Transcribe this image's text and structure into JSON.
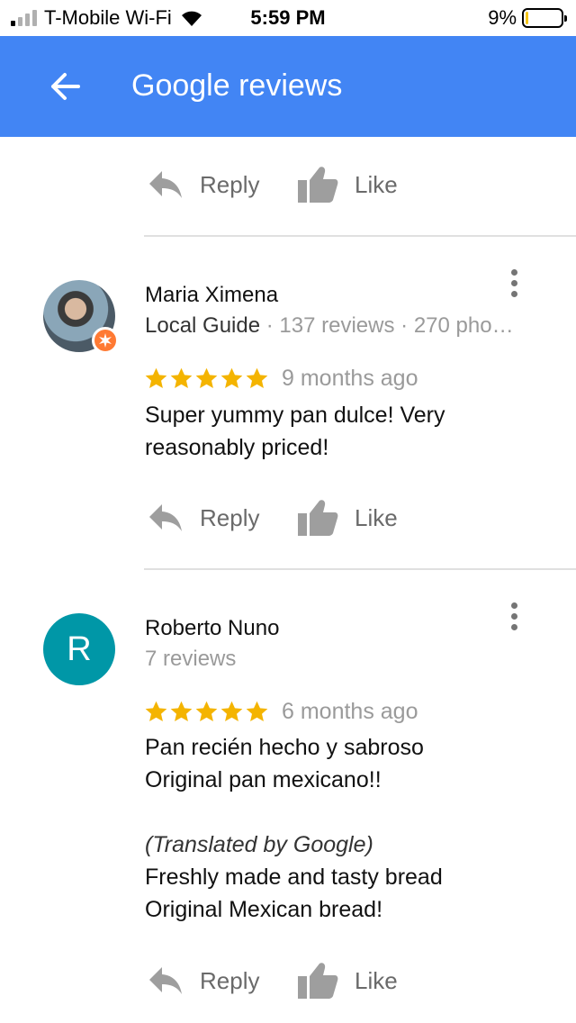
{
  "status_bar": {
    "carrier": "T-Mobile Wi-Fi",
    "time": "5:59 PM",
    "battery_percent": "9%",
    "battery_level": 0.09,
    "battery_color": "#f5c518",
    "signal_bars_active": 1,
    "signal_bars_total": 4
  },
  "app_bar": {
    "title": "Google reviews",
    "back_icon": "arrow-left-icon",
    "color": "#4285f4"
  },
  "actions": {
    "reply_label": "Reply",
    "like_label": "Like"
  },
  "reviews": [
    {
      "name": "Maria Ximena",
      "guide_label": "Local Guide",
      "meta": " · 137 reviews · 270 pho…",
      "stars": 5,
      "time_ago": "9 months ago",
      "text": "Super yummy pan dulce! Very\nreasonably priced!",
      "avatar": "profile-photo"
    },
    {
      "name": "Roberto Nuno",
      "meta": "7 reviews",
      "avatar_letter": "R",
      "avatar_color": "#0097a7",
      "stars": 5,
      "time_ago": "6 months ago",
      "text": "Pan recién hecho y sabroso\nOriginal pan mexicano!!",
      "translated_note": "(Translated by Google)",
      "translation": "Freshly made and tasty bread\nOriginal Mexican bread!"
    }
  ],
  "colors": {
    "star": "#f4b400",
    "action_gray": "#6a6a6a",
    "muted_text": "#9a9a9a"
  }
}
